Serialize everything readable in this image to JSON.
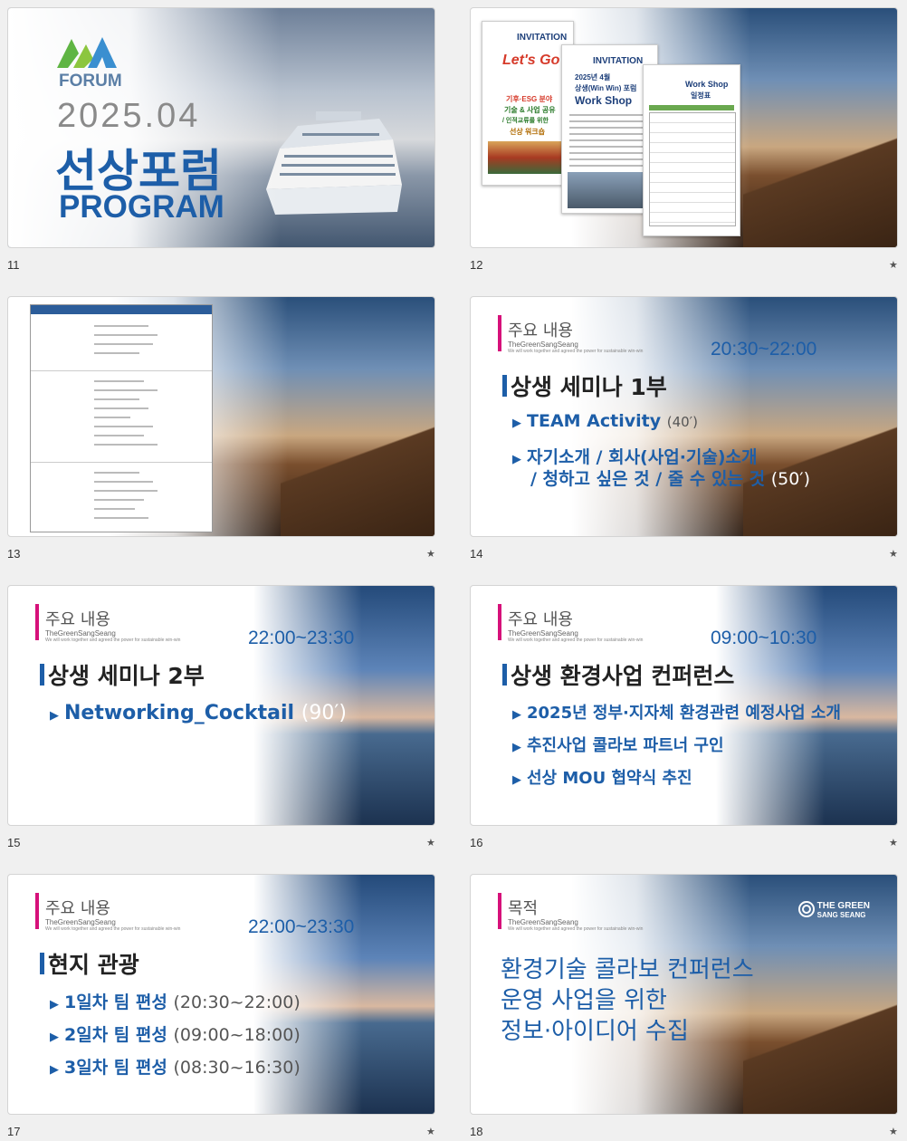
{
  "slides": [
    {
      "number": "11",
      "logo_text": "FORUM",
      "year": "2025.04",
      "title": "선상포럼",
      "program": "PROGRAM"
    },
    {
      "number": "12",
      "star": "★",
      "doc1": {
        "title": "INVITATION",
        "lets_go": "Let's Go",
        "topic1": "기후·ESG 분야",
        "topic2": "기술 & 사업 공유",
        "topic3": "/ 인적교류를 위한",
        "topic4": "선상 워크숍"
      },
      "doc2": {
        "title": "INVITATION",
        "line1": "2025년 4월",
        "line2": "상생(Win Win) 포럼",
        "line3": "Work Shop"
      },
      "doc3": {
        "title": "Work Shop",
        "sub": "일정표"
      }
    },
    {
      "number": "13",
      "star": "★"
    },
    {
      "number": "14",
      "star": "★",
      "header": "주요 내용",
      "sub1": "TheGreenSangSeang",
      "sub2": "We will work together and agreed the power for sustainable win-win",
      "time": "20:30~22:00",
      "title": "상생 세미나 1부",
      "items": [
        {
          "text": "TEAM Activity",
          "paren": "(40′)"
        },
        {
          "text": "자기소개 / 회사(사업·기술)소개",
          "text2": "/ 청하고 싶은 것 / 줄 수 있는 것",
          "paren": "(50′)"
        }
      ]
    },
    {
      "number": "15",
      "star": "★",
      "header": "주요 내용",
      "sub1": "TheGreenSangSeang",
      "sub2": "We will work together and agreed the power for sustainable win-win",
      "time": "22:00~23:30",
      "title": "상생 세미나 2부",
      "items": [
        {
          "text": "Networking_Cocktail",
          "paren": "(90′)"
        }
      ]
    },
    {
      "number": "16",
      "star": "★",
      "header": "주요 내용",
      "sub1": "TheGreenSangSeang",
      "sub2": "We will work together and agreed the power for sustainable win-win",
      "time": "09:00~10:30",
      "title": "상생 환경사업 컨퍼런스",
      "items": [
        {
          "text": "2025년 정부·지자체 환경관련 예정사업 소개"
        },
        {
          "text": "추진사업 콜라보 파트너 구인"
        },
        {
          "text": "선상 MOU 협약식 추진"
        }
      ]
    },
    {
      "number": "17",
      "star": "★",
      "header": "주요 내용",
      "sub1": "TheGreenSangSeang",
      "sub2": "We will work together and agreed the power for sustainable win-win",
      "time": "22:00~23:30",
      "title": "현지 관광",
      "items": [
        {
          "text": "1일차 팀 편성",
          "paren": "(20:30~22:00)"
        },
        {
          "text": "2일차 팀 편성",
          "paren": "(09:00~18:00)"
        },
        {
          "text": "3일차 팀 편성",
          "paren": "(08:30~16:30)"
        }
      ]
    },
    {
      "number": "18",
      "star": "★",
      "header": "목적",
      "sub1": "TheGreenSangSeang",
      "sub2": "We will work together and agreed the power for sustainable win-win",
      "brand1": "THE GREEN",
      "brand2": "SANG SEANG",
      "message": [
        "환경기술 콜라보 컨퍼런스",
        "운영 사업을 위한",
        "정보·아이디어 수집"
      ]
    }
  ]
}
